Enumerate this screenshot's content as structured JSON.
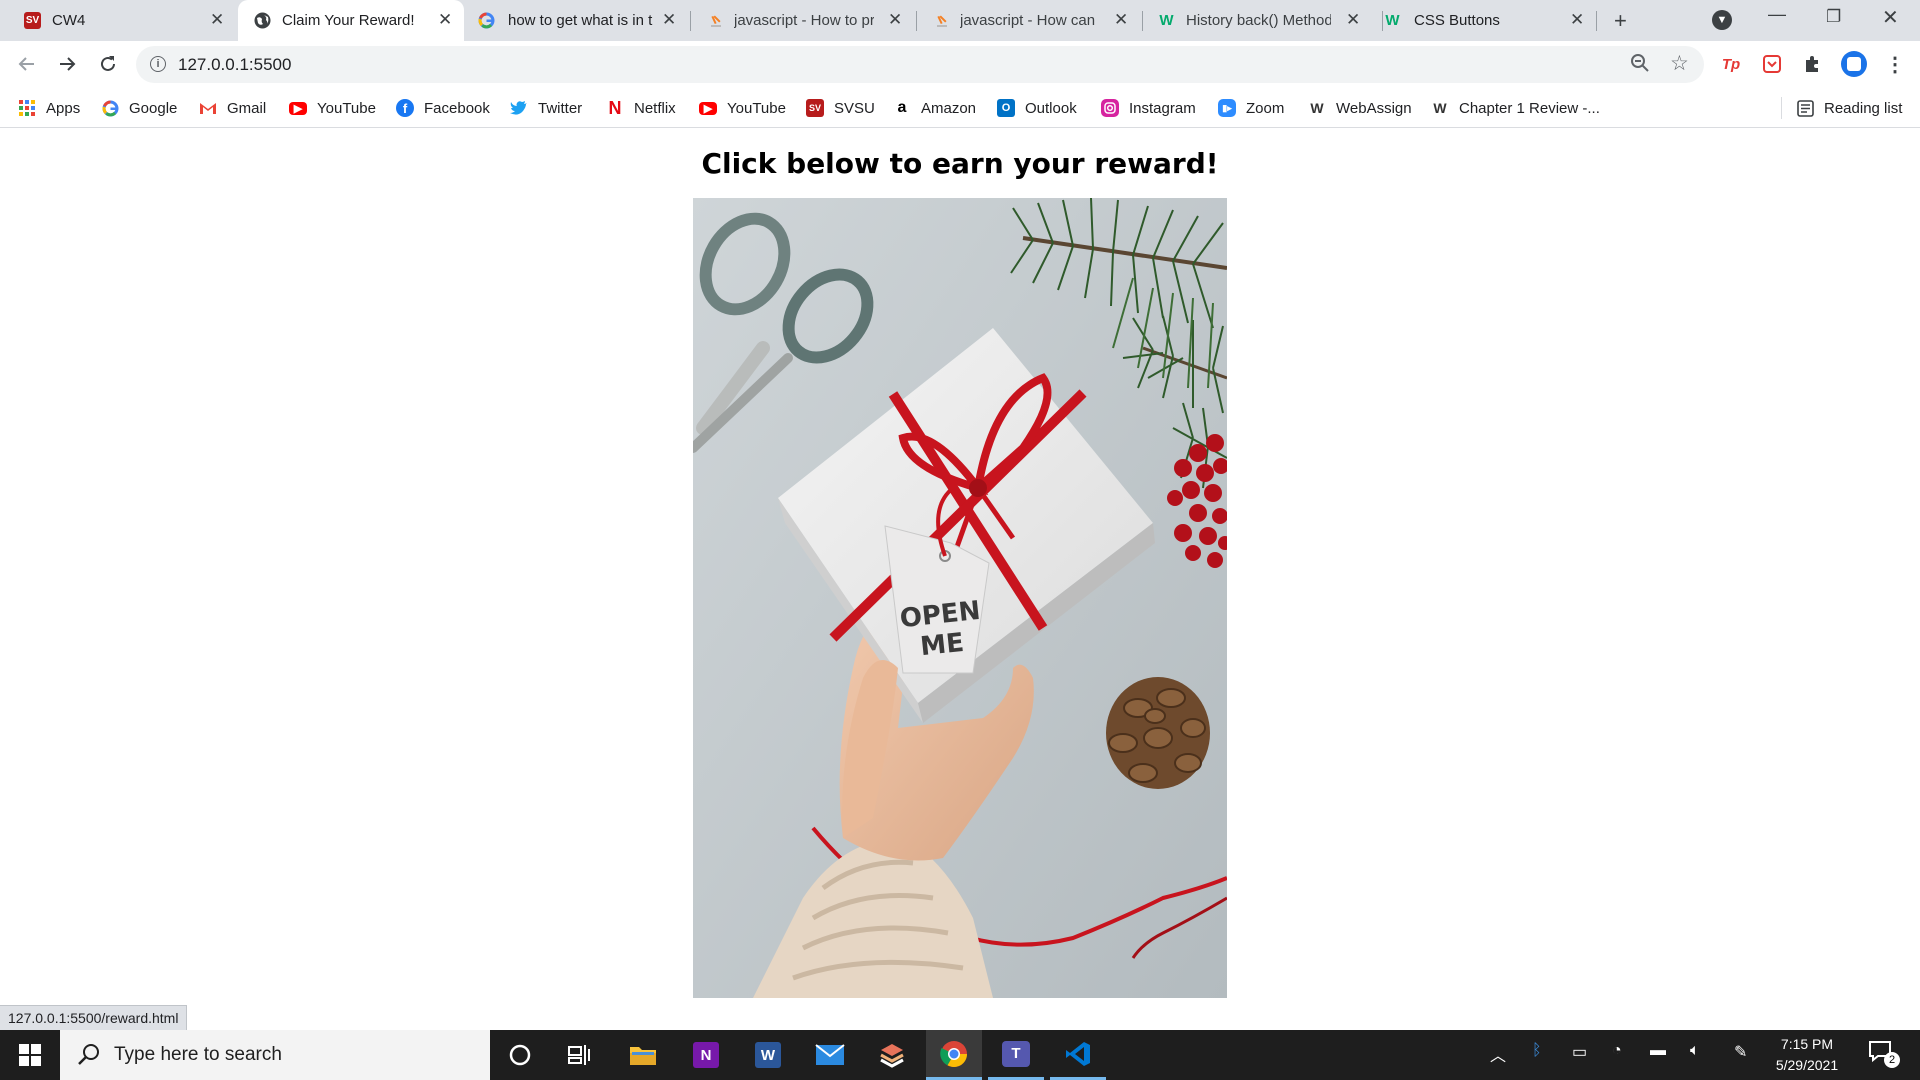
{
  "browser": {
    "tabs": [
      {
        "title": "CW4",
        "favicon": "svsu-icon"
      },
      {
        "title": "Claim Your Reward!",
        "favicon": "globe-icon",
        "active": true
      },
      {
        "title": "how to get what is in t",
        "favicon": "google-icon"
      },
      {
        "title": "javascript - How to pri",
        "favicon": "stackoverflow-icon"
      },
      {
        "title": "javascript - How can I",
        "favicon": "stackoverflow-icon"
      },
      {
        "title": "History back() Method",
        "favicon": "w3schools-icon"
      },
      {
        "title": "CSS Buttons",
        "favicon": "w3schools-icon"
      }
    ],
    "address": "127.0.0.1:5500",
    "bookmarks": [
      {
        "label": "Apps",
        "icon": "apps-grid-icon"
      },
      {
        "label": "Google",
        "icon": "google-icon"
      },
      {
        "label": "Gmail",
        "icon": "gmail-icon"
      },
      {
        "label": "YouTube",
        "icon": "youtube-icon"
      },
      {
        "label": "Facebook",
        "icon": "facebook-icon"
      },
      {
        "label": "Twitter",
        "icon": "twitter-icon"
      },
      {
        "label": "Netflix",
        "icon": "netflix-icon"
      },
      {
        "label": "YouTube",
        "icon": "youtube-icon"
      },
      {
        "label": "SVSU",
        "icon": "svsu-icon"
      },
      {
        "label": "Amazon",
        "icon": "amazon-icon"
      },
      {
        "label": "Outlook",
        "icon": "outlook-icon"
      },
      {
        "label": "Instagram",
        "icon": "instagram-icon"
      },
      {
        "label": "Zoom",
        "icon": "zoom-icon"
      },
      {
        "label": "WebAssign",
        "icon": "webassign-icon"
      },
      {
        "label": "Chapter 1 Review -...",
        "icon": "webassign-icon"
      }
    ],
    "reading_list": "Reading list",
    "status_url": "127.0.0.1:5500/reward.html"
  },
  "page": {
    "heading": "Click below to earn your reward!",
    "image": {
      "tag_line1": "OPEN",
      "tag_line2": "ME"
    }
  },
  "taskbar": {
    "search_placeholder": "Type here to search",
    "time": "7:15 PM",
    "date": "5/29/2021",
    "notification_count": "2"
  },
  "colors": {
    "tabstrip": "#dee1e6",
    "ribbon": "#c8141e",
    "taskbar": "#1e1e1e"
  }
}
